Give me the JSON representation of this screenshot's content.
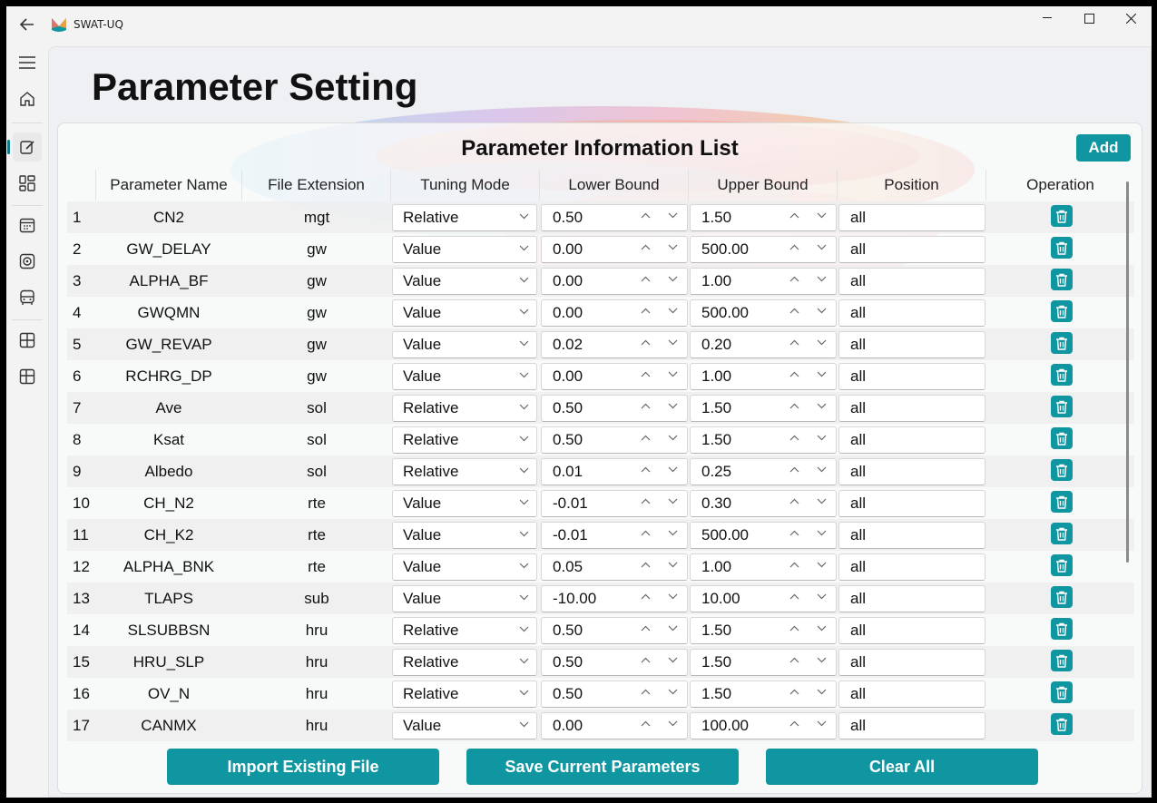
{
  "app": {
    "title": "SWAT-UQ"
  },
  "page": {
    "title": "Parameter Setting"
  },
  "card": {
    "title": "Parameter Information List",
    "add_label": "Add"
  },
  "table": {
    "headers": [
      "Parameter Name",
      "File Extension",
      "Tuning Mode",
      "Lower Bound",
      "Upper Bound",
      "Position",
      "Operation"
    ],
    "rows": [
      {
        "idx": "1",
        "name": "CN2",
        "ext": "mgt",
        "mode": "Relative",
        "lower": "0.50",
        "upper": "1.50",
        "pos": "all"
      },
      {
        "idx": "2",
        "name": "GW_DELAY",
        "ext": "gw",
        "mode": "Value",
        "lower": "0.00",
        "upper": "500.00",
        "pos": "all"
      },
      {
        "idx": "3",
        "name": "ALPHA_BF",
        "ext": "gw",
        "mode": "Value",
        "lower": "0.00",
        "upper": "1.00",
        "pos": "all"
      },
      {
        "idx": "4",
        "name": "GWQMN",
        "ext": "gw",
        "mode": "Value",
        "lower": "0.00",
        "upper": "500.00",
        "pos": "all"
      },
      {
        "idx": "5",
        "name": "GW_REVAP",
        "ext": "gw",
        "mode": "Value",
        "lower": "0.02",
        "upper": "0.20",
        "pos": "all"
      },
      {
        "idx": "6",
        "name": "RCHRG_DP",
        "ext": "gw",
        "mode": "Value",
        "lower": "0.00",
        "upper": "1.00",
        "pos": "all"
      },
      {
        "idx": "7",
        "name": "Ave",
        "ext": "sol",
        "mode": "Relative",
        "lower": "0.50",
        "upper": "1.50",
        "pos": "all"
      },
      {
        "idx": "8",
        "name": "Ksat",
        "ext": "sol",
        "mode": "Relative",
        "lower": "0.50",
        "upper": "1.50",
        "pos": "all"
      },
      {
        "idx": "9",
        "name": "Albedo",
        "ext": "sol",
        "mode": "Relative",
        "lower": "0.01",
        "upper": "0.25",
        "pos": "all"
      },
      {
        "idx": "10",
        "name": "CH_N2",
        "ext": "rte",
        "mode": "Value",
        "lower": "-0.01",
        "upper": "0.30",
        "pos": "all"
      },
      {
        "idx": "11",
        "name": "CH_K2",
        "ext": "rte",
        "mode": "Value",
        "lower": "-0.01",
        "upper": "500.00",
        "pos": "all"
      },
      {
        "idx": "12",
        "name": "ALPHA_BNK",
        "ext": "rte",
        "mode": "Value",
        "lower": "0.05",
        "upper": "1.00",
        "pos": "all"
      },
      {
        "idx": "13",
        "name": "TLAPS",
        "ext": "sub",
        "mode": "Value",
        "lower": "-10.00",
        "upper": "10.00",
        "pos": "all"
      },
      {
        "idx": "14",
        "name": "SLSUBBSN",
        "ext": "hru",
        "mode": "Relative",
        "lower": "0.50",
        "upper": "1.50",
        "pos": "all"
      },
      {
        "idx": "15",
        "name": "HRU_SLP",
        "ext": "hru",
        "mode": "Relative",
        "lower": "0.50",
        "upper": "1.50",
        "pos": "all"
      },
      {
        "idx": "16",
        "name": "OV_N",
        "ext": "hru",
        "mode": "Relative",
        "lower": "0.50",
        "upper": "1.50",
        "pos": "all"
      },
      {
        "idx": "17",
        "name": "CANMX",
        "ext": "hru",
        "mode": "Value",
        "lower": "0.00",
        "upper": "100.00",
        "pos": "all"
      }
    ]
  },
  "buttons": {
    "import": "Import Existing File",
    "save": "Save Current Parameters",
    "clear": "Clear All"
  },
  "colors": {
    "accent": "#0f96a0",
    "rail_indicator": "#0f7c8c"
  },
  "icons": {
    "rail": [
      "menu-icon",
      "home-icon",
      "edit-icon",
      "grid-icon",
      "calendar-icon",
      "target-icon",
      "bus-icon",
      "layout-icon",
      "layout-alt-icon"
    ],
    "operation": "trash-icon"
  }
}
